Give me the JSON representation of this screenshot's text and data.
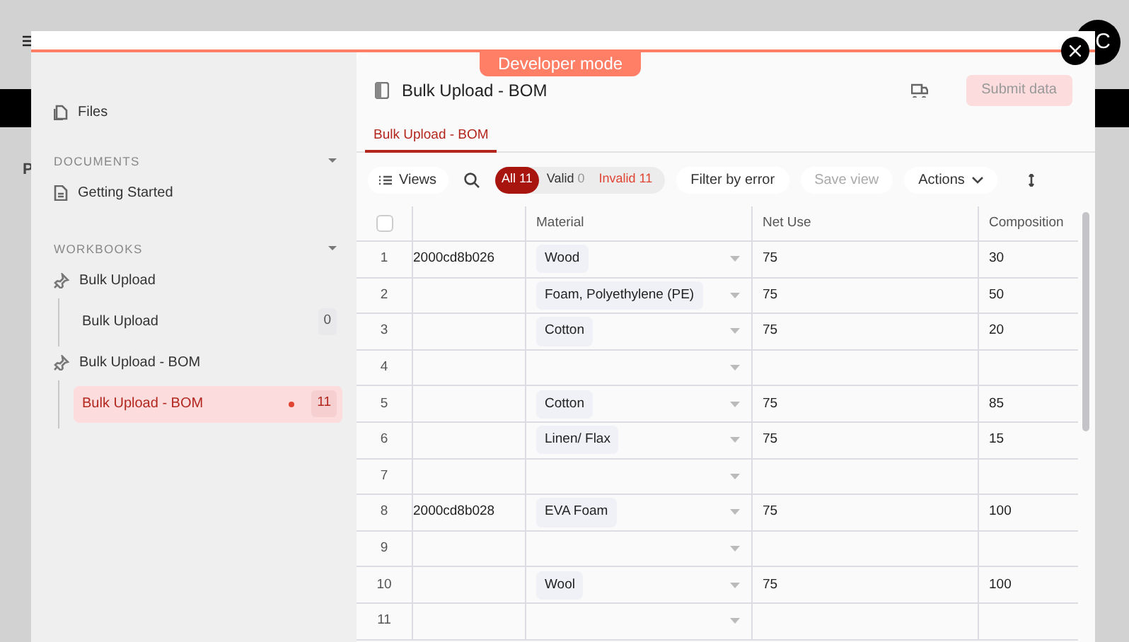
{
  "background": {
    "page_letter": "P",
    "avatar_initial": "C"
  },
  "developer_badge": "Developer mode",
  "sidebar": {
    "files": "Files",
    "sections": [
      {
        "title": "DOCUMENTS",
        "expanded": true,
        "items": [
          {
            "kind": "document",
            "label": "Getting Started"
          }
        ]
      },
      {
        "title": "WORKBOOKS",
        "expanded": true,
        "items": [
          {
            "kind": "workbook",
            "label": "Bulk Upload",
            "children": [
              {
                "label": "Bulk Upload",
                "count": "0",
                "selected": false,
                "has_errors": false
              }
            ]
          },
          {
            "kind": "workbook",
            "label": "Bulk Upload - BOM",
            "children": [
              {
                "label": "Bulk Upload - BOM",
                "count": "11",
                "selected": true,
                "has_errors": true
              }
            ]
          }
        ]
      }
    ]
  },
  "header": {
    "title": "Bulk Upload - BOM",
    "submit": {
      "label": "Submit data",
      "disabled": true
    }
  },
  "tabs": [
    {
      "label": "Bulk Upload - BOM",
      "selected": true
    }
  ],
  "toolbar": {
    "views": "Views",
    "filters": [
      {
        "kind": "all",
        "label": "All",
        "count": "11",
        "selected": true
      },
      {
        "kind": "valid",
        "label": "Valid",
        "count": "0",
        "selected": false
      },
      {
        "kind": "invalid",
        "label": "Invalid",
        "count": "11",
        "selected": false
      }
    ],
    "buttons": [
      {
        "label": "Filter by error",
        "disabled": false,
        "menu": false
      },
      {
        "label": "Save view",
        "disabled": true,
        "menu": false
      },
      {
        "label": "Actions",
        "disabled": false,
        "menu": true
      }
    ]
  },
  "table": {
    "all_checked": false,
    "columns": [
      "Material",
      "Net Use",
      "Composition"
    ],
    "rows": [
      {
        "number": "1",
        "column_2": "2000cd8b026",
        "material": "Wood",
        "net_use": "75",
        "composition": "30"
      },
      {
        "number": "2",
        "material": "Foam, Polyethylene (PE)",
        "net_use": "75",
        "composition": "50"
      },
      {
        "number": "3",
        "material": "Cotton",
        "net_use": "75",
        "composition": "20"
      },
      {
        "number": "4"
      },
      {
        "number": "5",
        "material": "Cotton",
        "net_use": "75",
        "composition": "85"
      },
      {
        "number": "6",
        "material": "Linen/ Flax",
        "net_use": "75",
        "composition": "15"
      },
      {
        "number": "7"
      },
      {
        "number": "8",
        "column_2": "2000cd8b028",
        "material": "EVA Foam",
        "net_use": "75",
        "composition": "100"
      },
      {
        "number": "9"
      },
      {
        "number": "10",
        "material": "Wool",
        "net_use": "75",
        "composition": "100"
      },
      {
        "number": "11"
      }
    ]
  }
}
